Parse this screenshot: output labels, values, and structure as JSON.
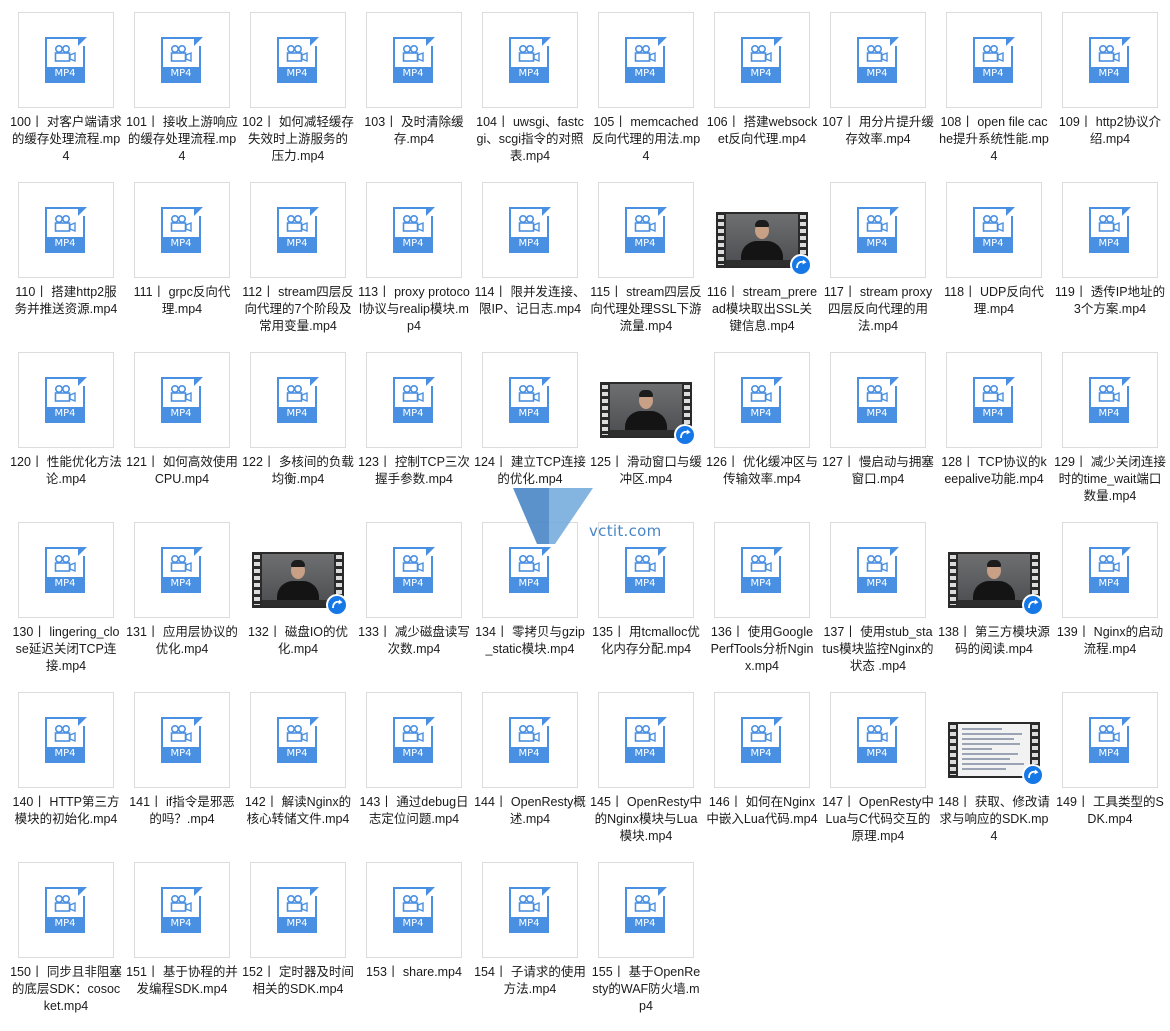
{
  "colors": {
    "mp4_blue": "#4a90e2",
    "badge_blue": "#1677e6",
    "watermark_blue": "#4a86c5"
  },
  "watermark": {
    "text": "vctit.com"
  },
  "files": [
    {
      "name": "100丨 对客户端请求的缓存处理流程.mp4",
      "thumb": "mp4-file-icon",
      "badge": "MP4"
    },
    {
      "name": "101丨 接收上游响应的缓存处理流程.mp4",
      "thumb": "mp4-file-icon",
      "badge": "MP4"
    },
    {
      "name": "102丨 如何减轻缓存失效时上游服务的压力.mp4",
      "thumb": "mp4-file-icon",
      "badge": "MP4"
    },
    {
      "name": "103丨 及时清除缓存.mp4",
      "thumb": "mp4-file-icon",
      "badge": "MP4"
    },
    {
      "name": "104丨 uwsgi、fastcgi、scgi指令的对照表.mp4",
      "thumb": "mp4-file-icon",
      "badge": "MP4"
    },
    {
      "name": "105丨 memcached反向代理的用法.mp4",
      "thumb": "mp4-file-icon",
      "badge": "MP4"
    },
    {
      "name": "106丨 搭建websocket反向代理.mp4",
      "thumb": "mp4-file-icon",
      "badge": "MP4"
    },
    {
      "name": "107丨 用分片提升缓存效率.mp4",
      "thumb": "mp4-file-icon",
      "badge": "MP4"
    },
    {
      "name": "108丨 open file cache提升系统性能.mp4",
      "thumb": "mp4-file-icon",
      "badge": "MP4"
    },
    {
      "name": "109丨 http2协议介绍.mp4",
      "thumb": "mp4-file-icon",
      "badge": "MP4"
    },
    {
      "name": "110丨 搭建http2服务并推送资源.mp4",
      "thumb": "mp4-file-icon",
      "badge": "MP4"
    },
    {
      "name": "111丨 grpc反向代理.mp4",
      "thumb": "mp4-file-icon",
      "badge": "MP4"
    },
    {
      "name": "112丨 stream四层反向代理的7个阶段及常用变量.mp4",
      "thumb": "mp4-file-icon",
      "badge": "MP4"
    },
    {
      "name": "113丨 proxy protocol协议与realip模块.mp4",
      "thumb": "mp4-file-icon",
      "badge": "MP4"
    },
    {
      "name": "114丨 限并发连接、限IP、记日志.mp4",
      "thumb": "mp4-file-icon",
      "badge": "MP4"
    },
    {
      "name": "115丨 stream四层反向代理处理SSL下游流量.mp4",
      "thumb": "mp4-file-icon",
      "badge": "MP4"
    },
    {
      "name": "116丨 stream_preread模块取出SSL关键信息.mp4",
      "thumb": "video-thumbnail",
      "badge": ""
    },
    {
      "name": "117丨 stream proxy四层反向代理的用法.mp4",
      "thumb": "mp4-file-icon",
      "badge": "MP4"
    },
    {
      "name": "118丨 UDP反向代理.mp4",
      "thumb": "mp4-file-icon",
      "badge": "MP4"
    },
    {
      "name": "119丨 透传IP地址的3个方案.mp4",
      "thumb": "mp4-file-icon",
      "badge": "MP4"
    },
    {
      "name": "120丨 性能优化方法论.mp4",
      "thumb": "mp4-file-icon",
      "badge": "MP4"
    },
    {
      "name": "121丨 如何高效使用CPU.mp4",
      "thumb": "mp4-file-icon",
      "badge": "MP4"
    },
    {
      "name": "122丨 多核间的负载均衡.mp4",
      "thumb": "mp4-file-icon",
      "badge": "MP4"
    },
    {
      "name": "123丨 控制TCP三次握手参数.mp4",
      "thumb": "mp4-file-icon",
      "badge": "MP4"
    },
    {
      "name": "124丨 建立TCP连接的优化.mp4",
      "thumb": "mp4-file-icon",
      "badge": "MP4"
    },
    {
      "name": "125丨 滑动窗口与缓冲区.mp4",
      "thumb": "video-thumbnail",
      "badge": ""
    },
    {
      "name": "126丨 优化缓冲区与传输效率.mp4",
      "thumb": "mp4-file-icon",
      "badge": "MP4"
    },
    {
      "name": "127丨 慢启动与拥塞窗口.mp4",
      "thumb": "mp4-file-icon",
      "badge": "MP4"
    },
    {
      "name": "128丨 TCP协议的keepalive功能.mp4",
      "thumb": "mp4-file-icon",
      "badge": "MP4"
    },
    {
      "name": "129丨 减少关闭连接时的time_wait端口数量.mp4",
      "thumb": "mp4-file-icon",
      "badge": "MP4"
    },
    {
      "name": "130丨 lingering_close延迟关闭TCP连接.mp4",
      "thumb": "mp4-file-icon",
      "badge": "MP4"
    },
    {
      "name": "131丨 应用层协议的优化.mp4",
      "thumb": "mp4-file-icon",
      "badge": "MP4"
    },
    {
      "name": "132丨 磁盘IO的优化.mp4",
      "thumb": "video-thumbnail",
      "badge": ""
    },
    {
      "name": "133丨 减少磁盘读写次数.mp4",
      "thumb": "mp4-file-icon",
      "badge": "MP4"
    },
    {
      "name": "134丨 零拷贝与gzip_static模块.mp4",
      "thumb": "mp4-file-icon",
      "badge": "MP4"
    },
    {
      "name": "135丨 用tcmalloc优化内存分配.mp4",
      "thumb": "mp4-file-icon",
      "badge": "MP4"
    },
    {
      "name": "136丨 使用Google PerfTools分析Nginx.mp4",
      "thumb": "mp4-file-icon",
      "badge": "MP4"
    },
    {
      "name": "137丨 使用stub_status模块监控Nginx的状态 .mp4",
      "thumb": "mp4-file-icon",
      "badge": "MP4"
    },
    {
      "name": "138丨 第三方模块源码的阅读.mp4",
      "thumb": "video-thumbnail",
      "badge": ""
    },
    {
      "name": "139丨 Nginx的启动流程.mp4",
      "thumb": "mp4-file-icon",
      "badge": "MP4"
    },
    {
      "name": "140丨 HTTP第三方模块的初始化.mp4",
      "thumb": "mp4-file-icon",
      "badge": "MP4"
    },
    {
      "name": "141丨 if指令是邪恶的吗？.mp4",
      "thumb": "mp4-file-icon",
      "badge": "MP4"
    },
    {
      "name": "142丨 解读Nginx的核心转储文件.mp4",
      "thumb": "mp4-file-icon",
      "badge": "MP4"
    },
    {
      "name": "143丨 通过debug日志定位问题.mp4",
      "thumb": "mp4-file-icon",
      "badge": "MP4"
    },
    {
      "name": "144丨 OpenResty概述.mp4",
      "thumb": "mp4-file-icon",
      "badge": "MP4"
    },
    {
      "name": "145丨 OpenResty中的Nginx模块与Lua模块.mp4",
      "thumb": "mp4-file-icon",
      "badge": "MP4"
    },
    {
      "name": "146丨 如何在Nginx中嵌入Lua代码.mp4",
      "thumb": "mp4-file-icon",
      "badge": "MP4"
    },
    {
      "name": "147丨 OpenResty中Lua与C代码交互的原理.mp4",
      "thumb": "mp4-file-icon",
      "badge": "MP4"
    },
    {
      "name": "148丨 获取、修改请求与响应的SDK.mp4",
      "thumb": "document-video-thumbnail",
      "badge": ""
    },
    {
      "name": "149丨 工具类型的SDK.mp4",
      "thumb": "mp4-file-icon",
      "badge": "MP4"
    },
    {
      "name": "150丨 同步且非阻塞的底层SDK：cosocket.mp4",
      "thumb": "mp4-file-icon",
      "badge": "MP4"
    },
    {
      "name": "151丨 基于协程的并发编程SDK.mp4",
      "thumb": "mp4-file-icon",
      "badge": "MP4"
    },
    {
      "name": "152丨 定时器及时间相关的SDK.mp4",
      "thumb": "mp4-file-icon",
      "badge": "MP4"
    },
    {
      "name": "153丨 share.mp4",
      "thumb": "mp4-file-icon",
      "badge": "MP4"
    },
    {
      "name": "154丨 子请求的使用方法.mp4",
      "thumb": "mp4-file-icon",
      "badge": "MP4"
    },
    {
      "name": "155丨 基于OpenResty的WAF防火墙.mp4",
      "thumb": "mp4-file-icon",
      "badge": "MP4"
    }
  ]
}
